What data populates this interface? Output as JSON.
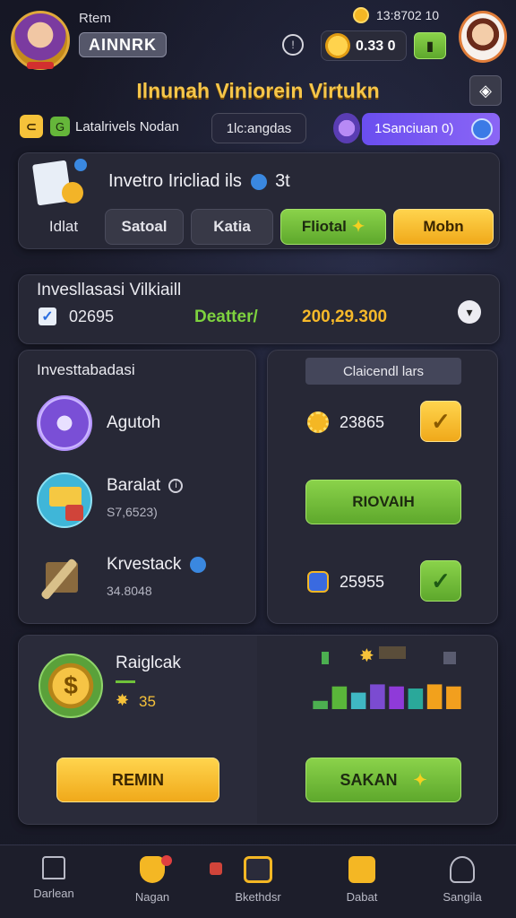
{
  "header": {
    "greeting": "Rtem",
    "username": "AINNRK",
    "clock": "13:8702 10",
    "coins": "0.33 0",
    "title": "Ilnunah Viniorein Virtukn"
  },
  "filters": {
    "chip1": "Latalrivels Nodan",
    "chip2": "1lc:angdas",
    "chip3": "1Sanciuan 0)"
  },
  "top_card": {
    "title": "Invetro Iricliad ils",
    "title_suffix": "3t",
    "tabs": [
      "Idlat",
      "Satoal",
      "Katia",
      "Fliotal",
      "Mobn"
    ]
  },
  "summary": {
    "title": "Invesllasasi Vilkiaill",
    "id": "02695",
    "status": "Deatter/",
    "amount": "200,29.300"
  },
  "investments": {
    "title": "Investtabadasi",
    "items": [
      {
        "name": "Agutoh",
        "sub": ""
      },
      {
        "name": "Baralat",
        "sub": "S7,6523)"
      },
      {
        "name": "Krvestack",
        "sub": "34.8048"
      }
    ]
  },
  "calc": {
    "title": "Claicendl lars",
    "value1": "23865",
    "button": "RIOVAIH",
    "value2": "25955"
  },
  "bottom": {
    "title": "Raiglcak",
    "count": "35",
    "left_button": "REMIN",
    "right_button": "SAKAN"
  },
  "bars": {
    "values": [
      0.2,
      0.55,
      0.4,
      0.6,
      0.55,
      0.5,
      0.6,
      0.55
    ],
    "colors": [
      "#4caf50",
      "#5ab63a",
      "#3fb8c4",
      "#7b4bd1",
      "#8f3ad9",
      "#2aa89a",
      "#f2a11c",
      "#f29f1e"
    ]
  },
  "nav": [
    "Darlean",
    "Nagan",
    "Bkethdsr",
    "Dabat",
    "Sangila"
  ],
  "colors": {
    "accent_green": "#6fc23a",
    "accent_yellow": "#f8c132",
    "accent_purple": "#7a5cf0"
  }
}
